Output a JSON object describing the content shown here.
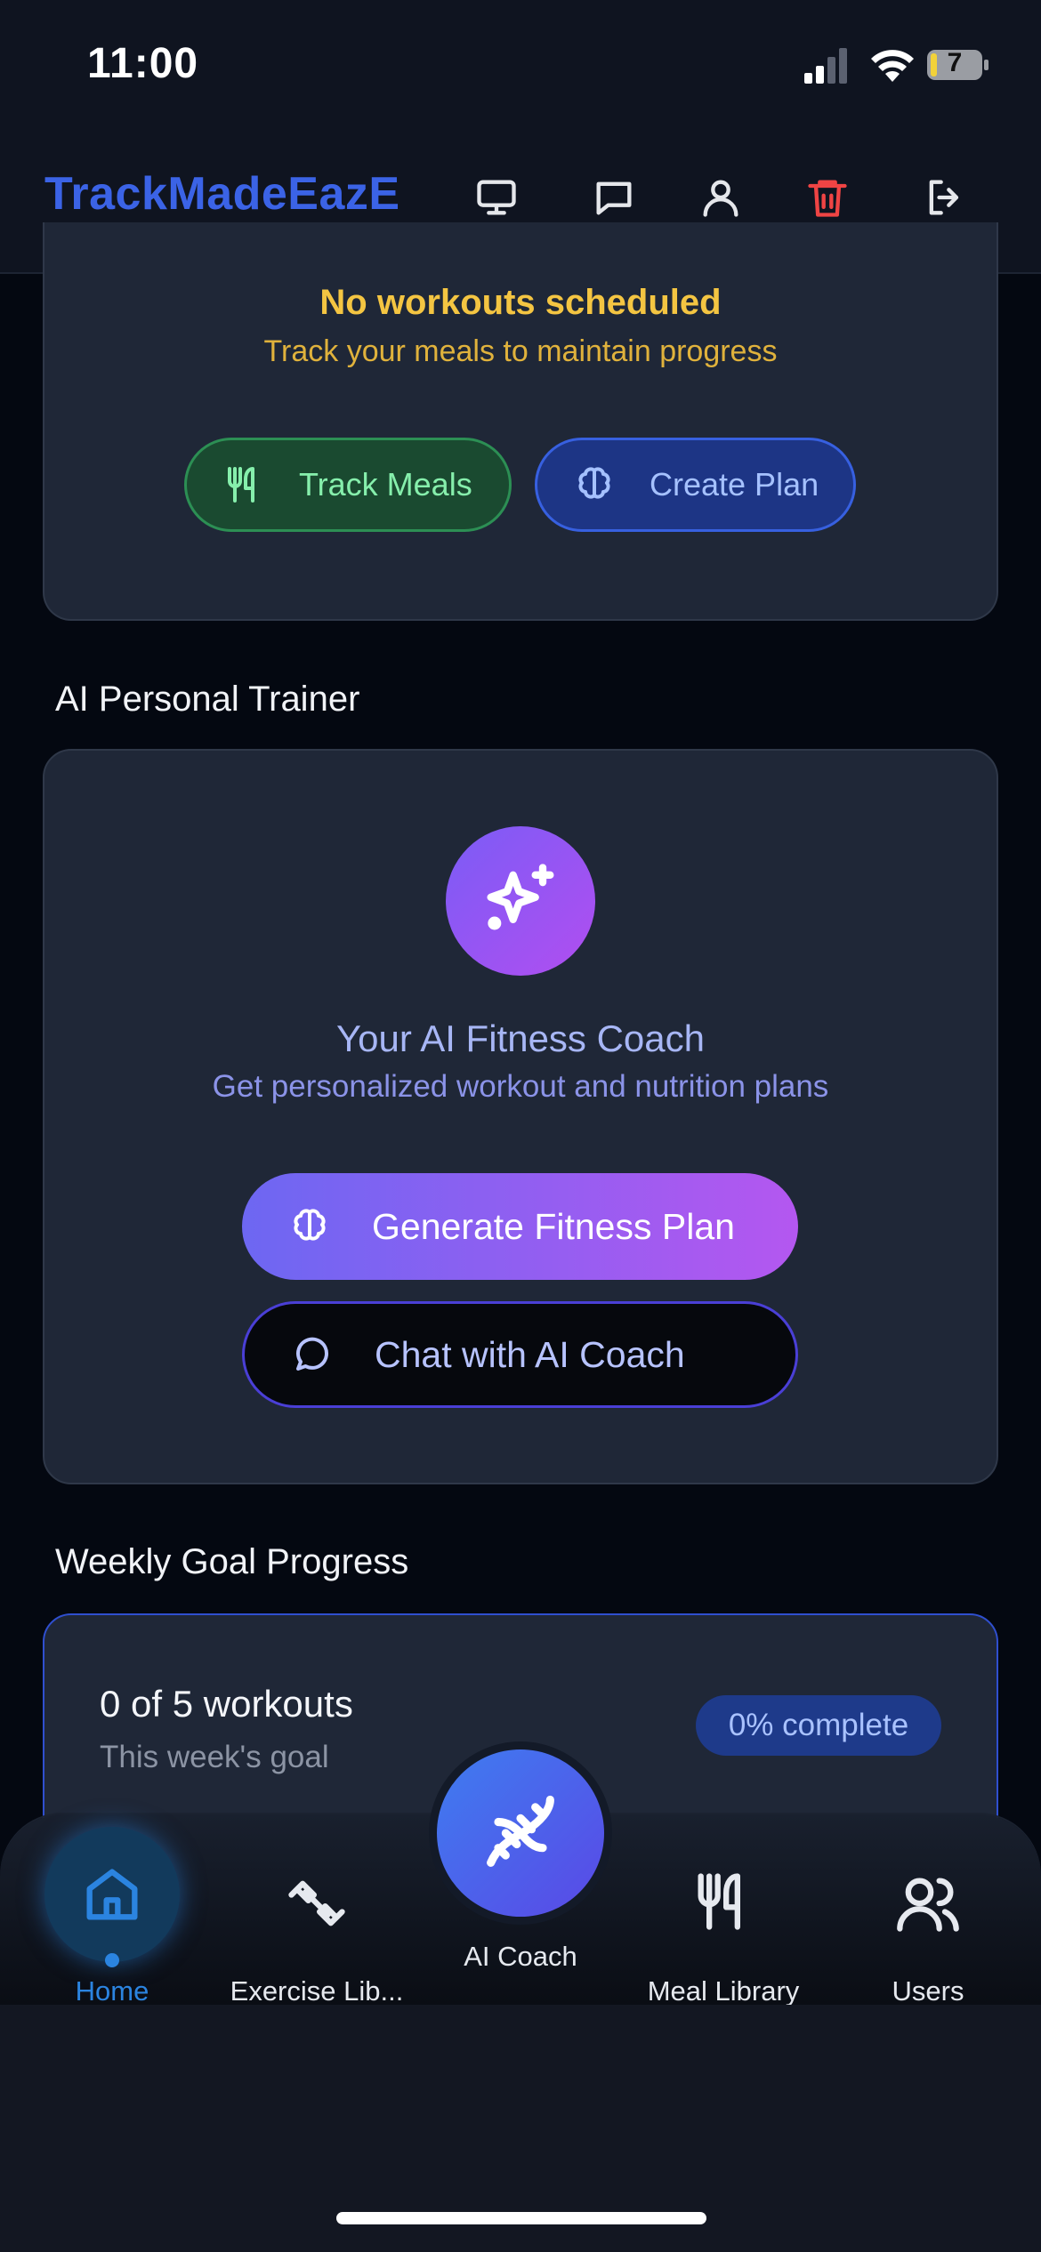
{
  "status_bar": {
    "time": "11:00",
    "battery": "7"
  },
  "header": {
    "brand": "TrackMadeEazE"
  },
  "schedule_card": {
    "title": "No workouts scheduled",
    "subtitle": "Track your meals to maintain progress",
    "track_meals_label": "Track Meals",
    "create_plan_label": "Create Plan"
  },
  "ai_section": {
    "heading": "AI Personal Trainer",
    "title": "Your AI Fitness Coach",
    "subtitle": "Get personalized workout and nutrition plans",
    "generate_label": "Generate Fitness Plan",
    "chat_label": "Chat with AI Coach"
  },
  "goal_section": {
    "heading": "Weekly Goal Progress",
    "count_text": "0 of 5 workouts",
    "subtitle": "This week's goal",
    "badge": "0% complete",
    "completed": 0,
    "target": 5,
    "percent": 0
  },
  "nav": {
    "home": "Home",
    "exercise": "Exercise Lib...",
    "ai_coach": "AI Coach",
    "meal": "Meal Library",
    "users": "Users"
  },
  "colors": {
    "brand": "#3b63e6",
    "warning": "#f4c542",
    "green_button": "#1a4a30",
    "blue_button": "#1d3585",
    "gradient_start": "#6d67f2",
    "gradient_end": "#b457f0",
    "active_nav": "#2b84e0",
    "delete": "#ef4444"
  },
  "icons": {
    "header": [
      "monitor-icon",
      "message-icon",
      "user-icon",
      "trash-icon",
      "logout-icon"
    ],
    "nav": [
      "home-icon",
      "dumbbell-icon",
      "dna-icon",
      "utensils-icon",
      "users-icon"
    ]
  }
}
